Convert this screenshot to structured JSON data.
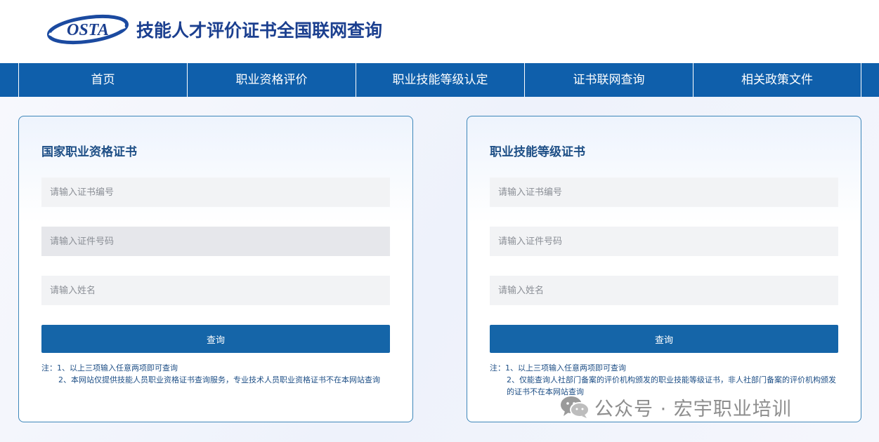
{
  "header": {
    "logo_text": "OSTA",
    "title": "技能人才评价证书全国联网查询"
  },
  "nav": {
    "items": [
      {
        "label": "首页"
      },
      {
        "label": "职业资格评价"
      },
      {
        "label": "职业技能等级认定"
      },
      {
        "label": "证书联网查询"
      },
      {
        "label": "相关政策文件"
      }
    ]
  },
  "panels": [
    {
      "title": "国家职业资格证书",
      "cert_no_placeholder": "请输入证书编号",
      "id_no_placeholder": "请输入证件号码",
      "name_placeholder": "请输入姓名",
      "query_label": "查询",
      "notes": [
        "注：1、以上三项输入任意两项即可查询",
        "2、本网站仅提供技能人员职业资格证书查询服务，专业技术人员职业资格证书不在本网站查询"
      ]
    },
    {
      "title": "职业技能等级证书",
      "cert_no_placeholder": "请输入证书编号",
      "id_no_placeholder": "请输入证件号码",
      "name_placeholder": "请输入姓名",
      "query_label": "查询",
      "notes": [
        "注：1、以上三项输入任意两项即可查询",
        "2、仅能查询人社部门备案的评价机构颁发的职业技能等级证书，非人社部门备案的评价机构颁发的证书不在本网站查询"
      ]
    }
  ],
  "watermark": {
    "text": "公众号 · 宏宇职业培训",
    "icon": "wechat-icon"
  },
  "colors": {
    "nav_bg": "#0f5fab",
    "title": "#1b3f8f",
    "button": "#1565a8",
    "panel_border": "#3d86b9"
  }
}
